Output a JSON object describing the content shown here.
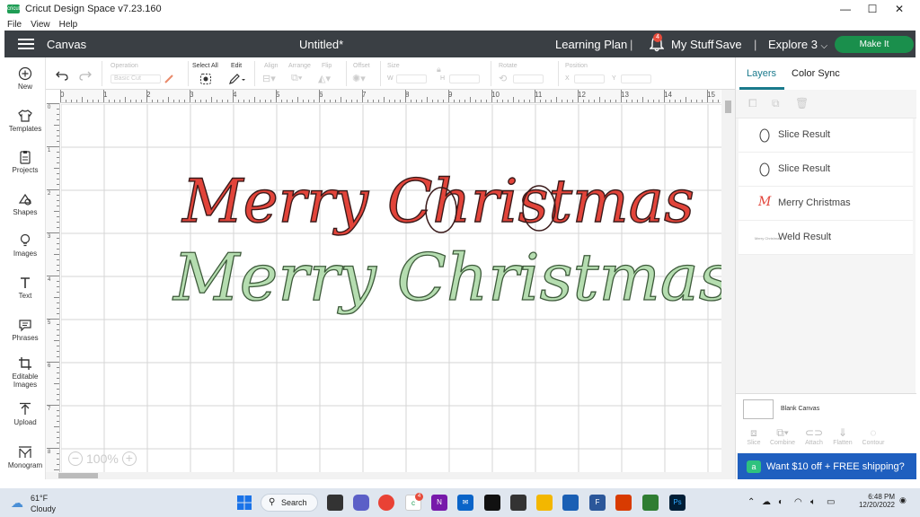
{
  "window": {
    "title": "Cricut Design Space  v7.23.160",
    "logo_text": "cricut",
    "minimize": "—",
    "maximize": "☐",
    "close": "✕"
  },
  "menu": [
    "File",
    "View",
    "Help"
  ],
  "header": {
    "section": "Canvas",
    "doc_title": "Untitled*",
    "learning_plan": "Learning Plan",
    "separator": "|",
    "notification_count": "4",
    "my_stuff": "My Stuff",
    "save": "Save",
    "machine": "Explore 3",
    "make_it": "Make It",
    "colors": {
      "header_bg": "#3a3f44",
      "make_it": "#1a8f4c"
    }
  },
  "left_tools": [
    {
      "id": "new",
      "label": "New",
      "icon": "plus-circle-icon"
    },
    {
      "id": "templates",
      "label": "Templates",
      "icon": "shirt-icon"
    },
    {
      "id": "projects",
      "label": "Projects",
      "icon": "clipboard-icon"
    },
    {
      "id": "shapes",
      "label": "Shapes",
      "icon": "shapes-icon"
    },
    {
      "id": "images",
      "label": "Images",
      "icon": "bulb-icon"
    },
    {
      "id": "text",
      "label": "Text",
      "icon": "text-icon"
    },
    {
      "id": "phrases",
      "label": "Phrases",
      "icon": "speech-bubble-icon"
    },
    {
      "id": "editable-images",
      "label": "Editable Images",
      "icon": "crop-icon"
    },
    {
      "id": "upload",
      "label": "Upload",
      "icon": "upload-icon"
    },
    {
      "id": "monogram",
      "label": "Monogram",
      "icon": "monogram-icon"
    }
  ],
  "toolbar": {
    "operation_label": "Operation",
    "operation_value": "Basic Cut",
    "select_all": "Select All",
    "edit": "Edit",
    "align": "Align",
    "arrange": "Arrange",
    "flip": "Flip",
    "offset": "Offset",
    "size": "Size",
    "w": "W",
    "h": "H",
    "rotate": "Rotate",
    "position": "Position",
    "x": "X",
    "y": "Y"
  },
  "canvas": {
    "ruler_top": [
      "0",
      "1",
      "2",
      "3",
      "4",
      "5",
      "6",
      "7",
      "8",
      "9",
      "10",
      "11",
      "12",
      "13",
      "14",
      "15"
    ],
    "ruler_left": [
      "0",
      "1",
      "2",
      "3",
      "4",
      "5",
      "6",
      "7",
      "8"
    ],
    "zoom": "100%",
    "zoom_minus": "−",
    "zoom_plus": "+",
    "text_top": "Merry Christmas",
    "text_bottom": "Merry Christmas",
    "colors": {
      "red_fill": "#e2443a",
      "green_fill": "#b5ddb0",
      "outline": "#3a1a1a"
    }
  },
  "right_panel": {
    "tab_layers": "Layers",
    "tab_color_sync": "Color Sync",
    "layers": [
      {
        "name": "Slice Result",
        "thumb": "oval-outline"
      },
      {
        "name": "Slice Result",
        "thumb": "oval-outline"
      },
      {
        "name": "Merry Christmas",
        "thumb": "script-m"
      },
      {
        "name": "Weld Result",
        "thumb": "mini-text"
      }
    ],
    "layer_thumb_letter": "M",
    "layer_thumb_mini": "Merry Christmas",
    "blank_canvas": "Blank Canvas",
    "bottom_tools": [
      "Slice",
      "Combine",
      "Attach",
      "Flatten",
      "Contour"
    ],
    "promo": "Want $10 off + FREE shipping?",
    "promo_icon": "a",
    "accent": "#1a7a8c",
    "promo_bg": "#1f5fbf"
  },
  "taskbar": {
    "temperature": "61°F",
    "weather": "Cloudy",
    "search": "Search",
    "cricut_badge": "4",
    "time": "6:48 PM",
    "date": "12/20/2022"
  }
}
